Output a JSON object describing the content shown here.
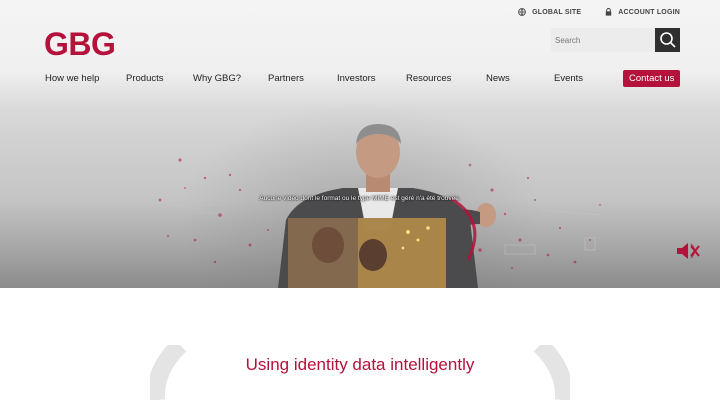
{
  "topbar": {
    "global_site": "GLOBAL SITE",
    "account_login": "ACCOUNT LOGIN"
  },
  "logo": {
    "text": "GBG"
  },
  "search": {
    "placeholder": "Search"
  },
  "nav": {
    "items": [
      "How we help",
      "Products",
      "Why GBG?",
      "Partners",
      "Investors",
      "Resources",
      "News",
      "Events"
    ],
    "contact": "Contact us"
  },
  "hero": {
    "video_message": "Aucune vidéo dont le format ou le type MIME est géré n'a été trouvée."
  },
  "section": {
    "title": "Using identity data intelligently"
  },
  "colors": {
    "brand": "#b4123a",
    "search_button": "#2f2f2f"
  },
  "icons": {
    "globe": "globe-icon",
    "lock": "lock-icon",
    "search": "search-icon",
    "mute": "speaker-muted-icon"
  }
}
